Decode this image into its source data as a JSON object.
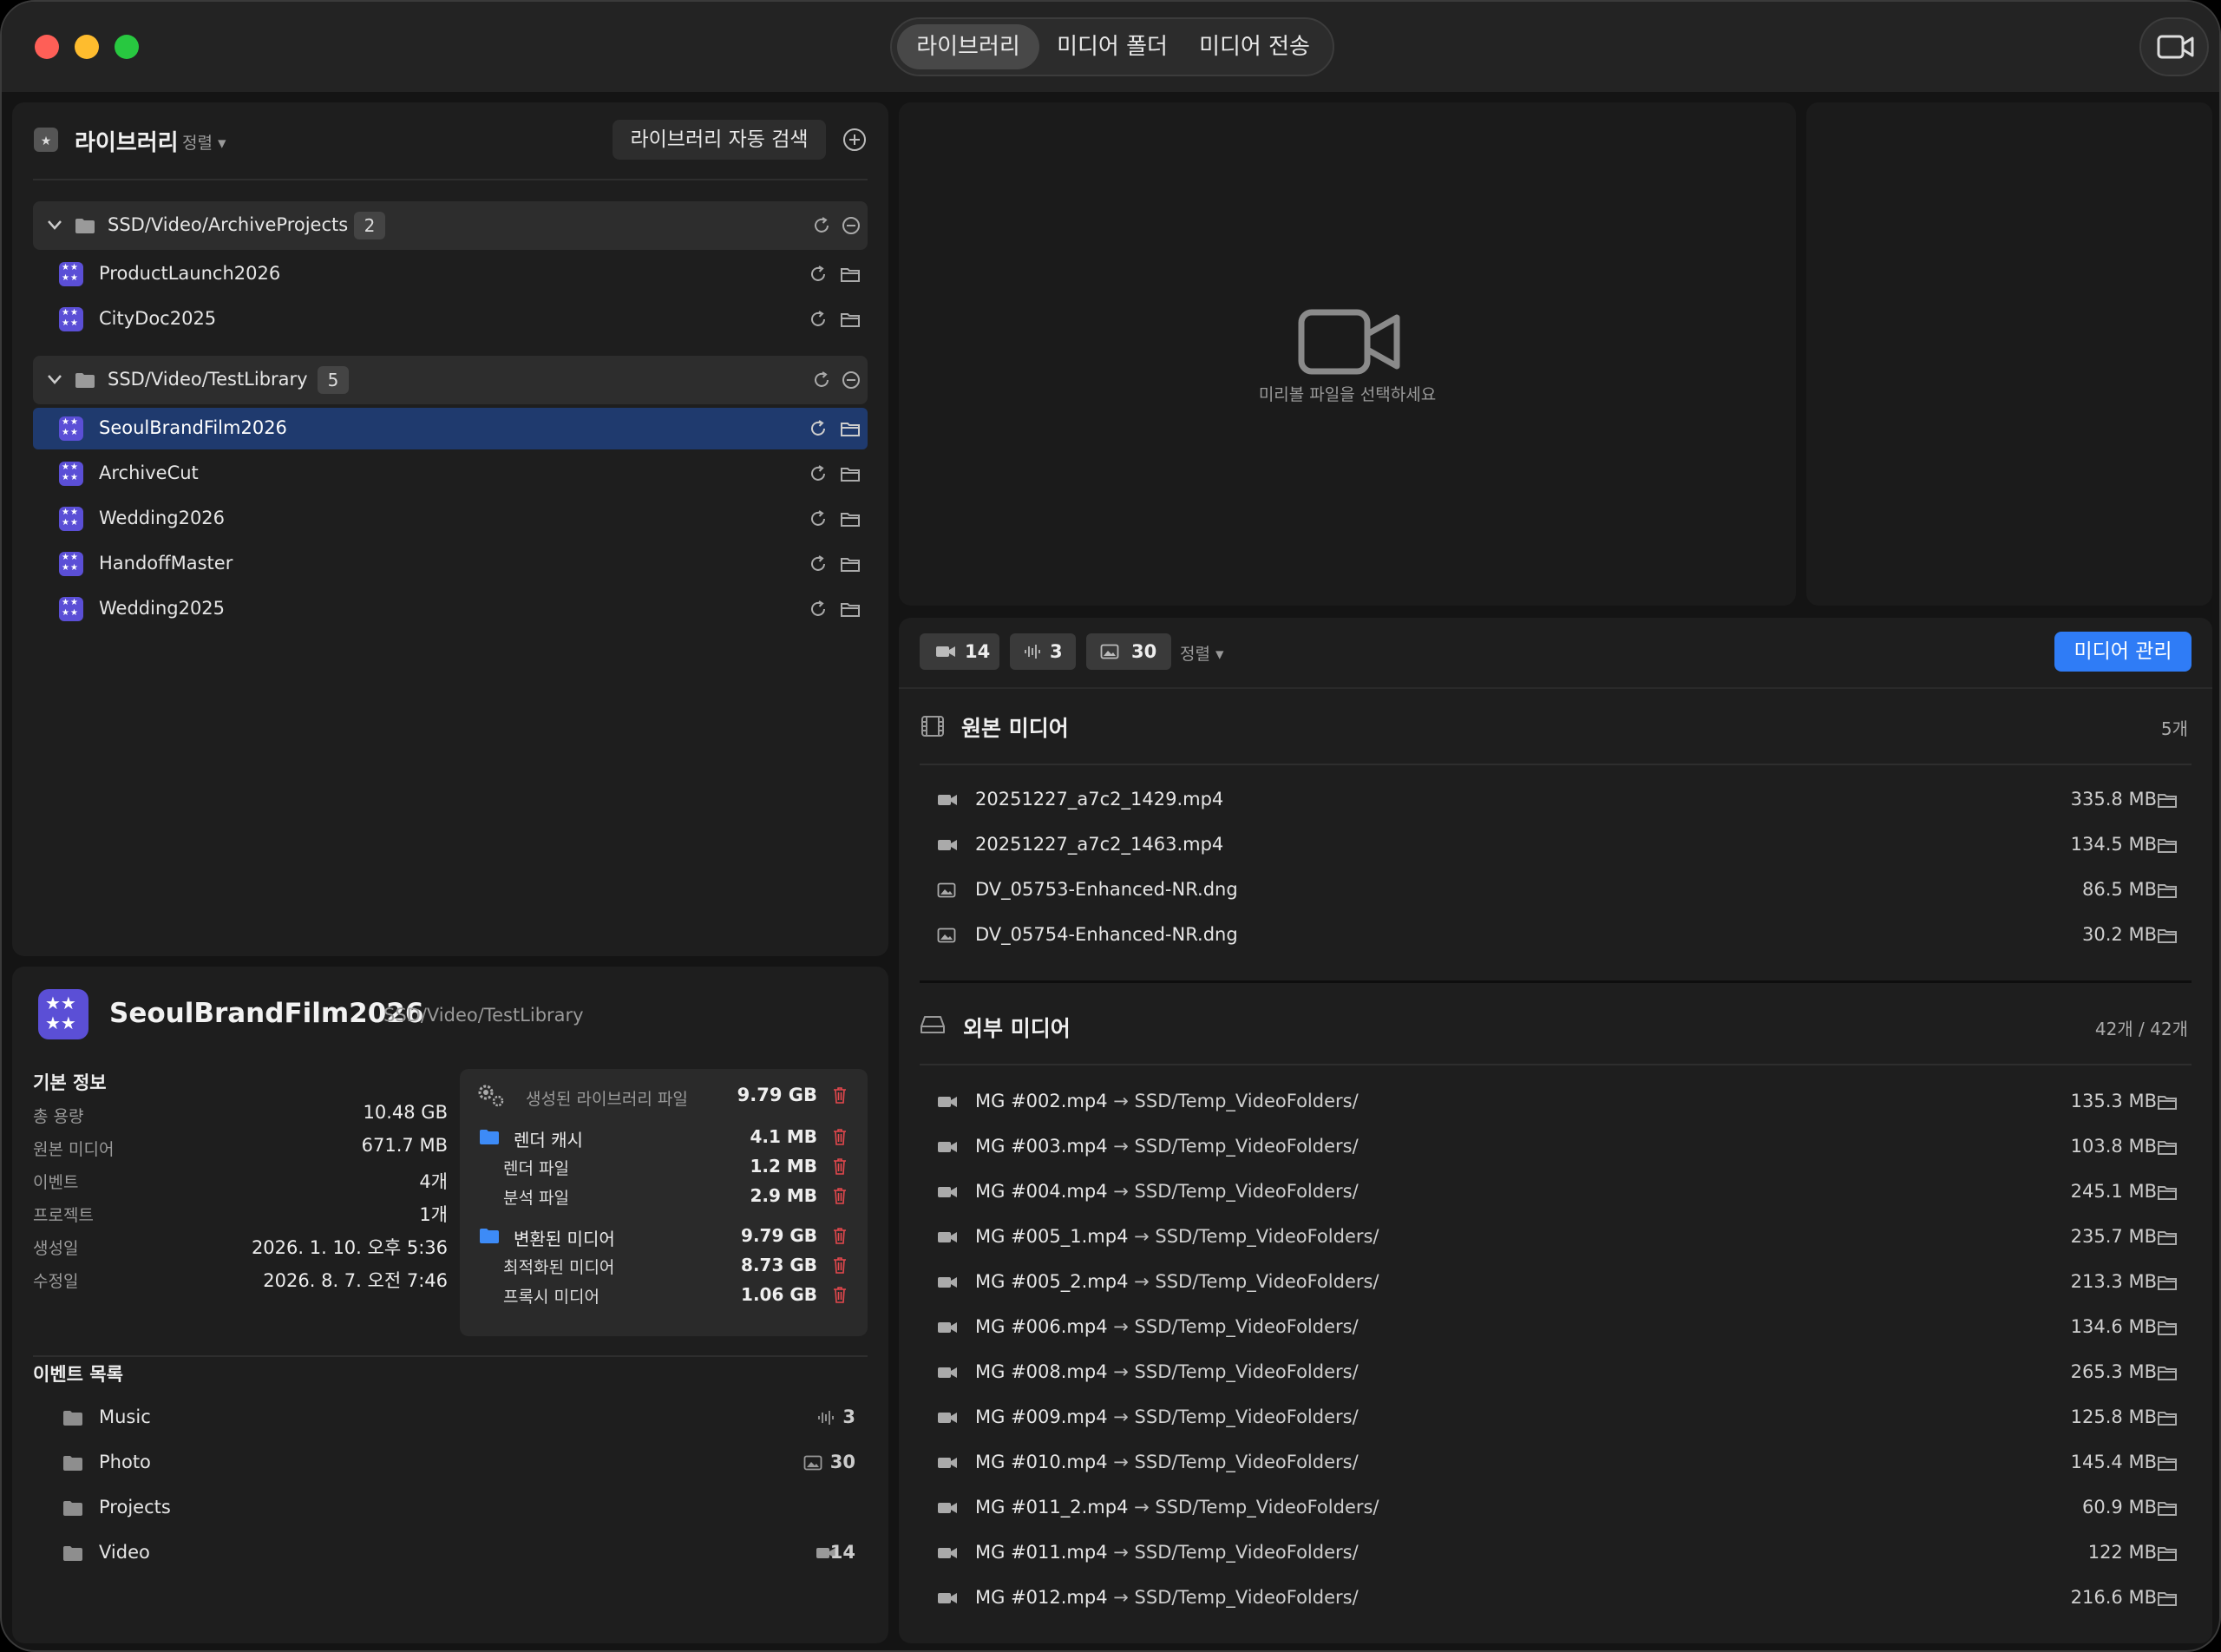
{
  "tabs": [
    {
      "label": "라이브러리",
      "active": true
    },
    {
      "label": "미디어 폴더"
    },
    {
      "label": "미디어 전송"
    }
  ],
  "library": {
    "title": "라이브러리",
    "sort_label": "정렬 ▾",
    "auto_search": "라이브러리 자동 검색",
    "groups": [
      {
        "path": "SSD/Video/ArchiveProjects",
        "count": "2",
        "items": [
          "ProductLaunch2026",
          "CityDoc2025"
        ]
      },
      {
        "path": "SSD/Video/TestLibrary",
        "count": "5",
        "items": [
          "SeoulBrandFilm2026",
          "ArchiveCut",
          "Wedding2026",
          "HandoffMaster",
          "Wedding2025"
        ],
        "selected": "SeoulBrandFilm2026"
      }
    ]
  },
  "preview": {
    "placeholder": "미리볼 파일을 선택하세요"
  },
  "detail": {
    "name": "SeoulBrandFilm2026",
    "path": "SSD/Video/TestLibrary",
    "basic_title": "기본 정보",
    "basic": [
      {
        "k": "총 용량",
        "v": "10.48 GB"
      },
      {
        "k": "원본 미디어",
        "v": "671.7 MB"
      },
      {
        "k": "이벤트",
        "v": "4개"
      },
      {
        "k": "프로젝트",
        "v": "1개"
      },
      {
        "k": "생성일",
        "v": "2026. 1. 10. 오후 5:36"
      },
      {
        "k": "수정일",
        "v": "2026. 8. 7. 오전 7:46"
      }
    ],
    "generated": {
      "label": "생성된 라이브러리 파일",
      "value": "9.79 GB"
    },
    "render_cache": {
      "label": "렌더 캐시",
      "value": "4.1 MB",
      "children": [
        {
          "k": "렌더 파일",
          "v": "1.2 MB"
        },
        {
          "k": "분석 파일",
          "v": "2.9 MB"
        }
      ]
    },
    "converted": {
      "label": "변환된 미디어",
      "value": "9.79 GB",
      "children": [
        {
          "k": "최적화된 미디어",
          "v": "8.73 GB"
        },
        {
          "k": "프록시 미디어",
          "v": "1.06 GB"
        }
      ]
    },
    "events_title": "이벤트 목록",
    "events": [
      {
        "name": "Music",
        "count": "3",
        "icon": "audio-icon"
      },
      {
        "name": "Photo",
        "count": "30",
        "icon": "image-icon"
      },
      {
        "name": "Projects",
        "count": "",
        "icon": ""
      },
      {
        "name": "Video",
        "count": "14",
        "icon": "video-icon"
      }
    ]
  },
  "media": {
    "counts": {
      "video": "14",
      "audio": "3",
      "image": "30"
    },
    "sort_label": "정렬 ▾",
    "manage_btn": "미디어 관리",
    "original": {
      "title": "원본 미디어",
      "count": "5개",
      "files": [
        {
          "name": "20251227_a7c2_1429.mp4",
          "size": "335.8 MB",
          "type": "video"
        },
        {
          "name": "20251227_a7c2_1463.mp4",
          "size": "134.5 MB",
          "type": "video"
        },
        {
          "name": "DV_05753-Enhanced-NR.dng",
          "size": "86.5 MB",
          "type": "image"
        },
        {
          "name": "DV_05754-Enhanced-NR.dng",
          "size": "30.2 MB",
          "type": "image"
        }
      ]
    },
    "external": {
      "title": "외부 미디어",
      "count": "42개 / 42개",
      "files": [
        {
          "name": "MG #002.mp4",
          "dest": "SSD/Temp_VideoFolders/",
          "size": "135.3 MB"
        },
        {
          "name": "MG #003.mp4",
          "dest": "SSD/Temp_VideoFolders/",
          "size": "103.8 MB"
        },
        {
          "name": "MG #004.mp4",
          "dest": "SSD/Temp_VideoFolders/",
          "size": "245.1 MB"
        },
        {
          "name": "MG #005_1.mp4",
          "dest": "SSD/Temp_VideoFolders/",
          "size": "235.7 MB"
        },
        {
          "name": "MG #005_2.mp4",
          "dest": "SSD/Temp_VideoFolders/",
          "size": "213.3 MB"
        },
        {
          "name": "MG #006.mp4",
          "dest": "SSD/Temp_VideoFolders/",
          "size": "134.6 MB"
        },
        {
          "name": "MG #008.mp4",
          "dest": "SSD/Temp_VideoFolders/",
          "size": "265.3 MB"
        },
        {
          "name": "MG #009.mp4",
          "dest": "SSD/Temp_VideoFolders/",
          "size": "125.8 MB"
        },
        {
          "name": "MG #010.mp4",
          "dest": "SSD/Temp_VideoFolders/",
          "size": "145.4 MB"
        },
        {
          "name": "MG #011_2.mp4",
          "dest": "SSD/Temp_VideoFolders/",
          "size": "60.9 MB"
        },
        {
          "name": "MG #011.mp4",
          "dest": "SSD/Temp_VideoFolders/",
          "size": "122 MB"
        },
        {
          "name": "MG #012.mp4",
          "dest": "SSD/Temp_VideoFolders/",
          "size": "216.6 MB"
        }
      ]
    }
  },
  "colors": {
    "accent": "#2f7cf6",
    "selection": "#1f3a6e",
    "trash": "#e5484d",
    "folder": "#3d8bf7",
    "appicon": "#5b4fd6"
  }
}
